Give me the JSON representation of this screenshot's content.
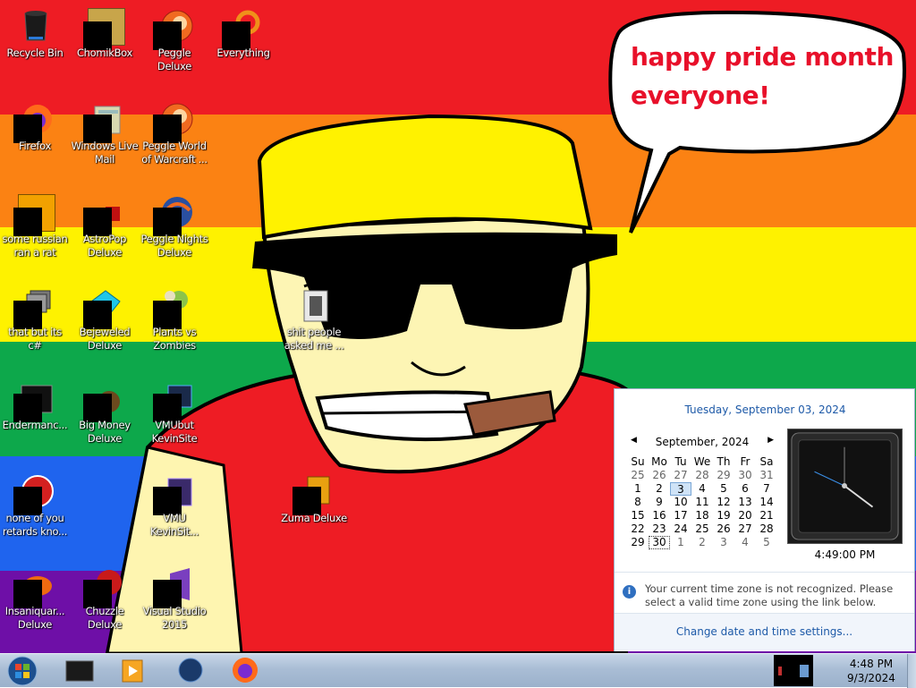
{
  "desktop": {
    "bubble_line1": "happy pride month",
    "bubble_line2": "everyone!",
    "icons": [
      {
        "label": "Recycle Bin"
      },
      {
        "label": "ChomikBox"
      },
      {
        "label": "Peggle Deluxe"
      },
      {
        "label": "Everything"
      },
      {
        "label": "Firefox"
      },
      {
        "label": "Windows Live Mail"
      },
      {
        "label": "Peggle World of Warcraft ..."
      },
      {
        "label": "some russian ran a rat"
      },
      {
        "label": "AstroPop Deluxe"
      },
      {
        "label": "Peggle Nights Deluxe"
      },
      {
        "label": "that but its c#"
      },
      {
        "label": "Bejeweled Deluxe"
      },
      {
        "label": "Plants vs Zombies"
      },
      {
        "label": "shit people asked me ..."
      },
      {
        "label": "Endermanc..."
      },
      {
        "label": "Big Money Deluxe"
      },
      {
        "label": "VMUbut KevinSite"
      },
      {
        "label": "none of you retards kno..."
      },
      {
        "label": "VMU KevinSit..."
      },
      {
        "label": "Zuma Deluxe"
      },
      {
        "label": "Insaniquar... Deluxe"
      },
      {
        "label": "Chuzzle Deluxe"
      },
      {
        "label": "Visual Studio 2015"
      }
    ]
  },
  "popup": {
    "date_line": "Tuesday, September 03, 2024",
    "month_label": "September, 2024",
    "weekdays": [
      "Su",
      "Mo",
      "Tu",
      "We",
      "Th",
      "Fr",
      "Sa"
    ],
    "weeks": [
      [
        "25",
        "26",
        "27",
        "28",
        "29",
        "30",
        "31"
      ],
      [
        "1",
        "2",
        "3",
        "4",
        "5",
        "6",
        "7"
      ],
      [
        "8",
        "9",
        "10",
        "11",
        "12",
        "13",
        "14"
      ],
      [
        "15",
        "16",
        "17",
        "18",
        "19",
        "20",
        "21"
      ],
      [
        "22",
        "23",
        "24",
        "25",
        "26",
        "27",
        "28"
      ],
      [
        "29",
        "30",
        "1",
        "2",
        "3",
        "4",
        "5"
      ]
    ],
    "clock_time": "4:49:00 PM",
    "timezone_message": "Your current time zone is not recognized. Please select a valid time zone using the link below.",
    "change_link": "Change date and time settings..."
  },
  "taskbar": {
    "time": "4:48 PM",
    "date": "9/3/2024"
  }
}
